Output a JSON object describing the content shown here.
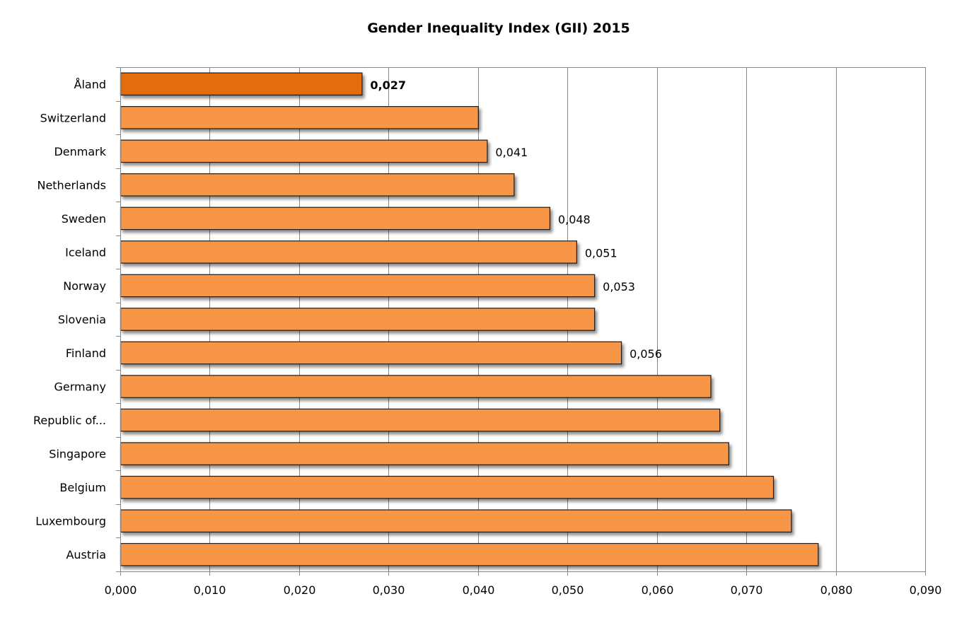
{
  "chart_data": {
    "type": "bar",
    "orientation": "horizontal",
    "title": "Gender Inequality Index (GII) 2015",
    "xlabel": "",
    "ylabel": "",
    "xlim": [
      0,
      0.09
    ],
    "grid": true,
    "legend": "none",
    "categories": [
      "Åland",
      "Switzerland",
      "Denmark",
      "Netherlands",
      "Sweden",
      "Iceland",
      "Norway",
      "Slovenia",
      "Finland",
      "Germany",
      "Republic of...",
      "Singapore",
      "Belgium",
      "Luxembourg",
      "Austria"
    ],
    "values": [
      0.027,
      0.04,
      0.041,
      0.044,
      0.048,
      0.051,
      0.053,
      0.053,
      0.056,
      0.066,
      0.067,
      0.068,
      0.073,
      0.075,
      0.078
    ],
    "data_labels": [
      "0,027",
      "",
      "0,041",
      "",
      "0,048",
      "0,051",
      "0,053",
      "",
      "0,056",
      "",
      "",
      "",
      "",
      "",
      ""
    ],
    "highlight_index": 0,
    "x_ticks": [
      "0,000",
      "0,010",
      "0,020",
      "0,030",
      "0,040",
      "0,050",
      "0,060",
      "0,070",
      "0,080",
      "0,090"
    ],
    "colors": {
      "highlight": "#E36C0A",
      "bar": "#F79646",
      "bar_border": "#1a1a1a",
      "grid": "#868686"
    }
  }
}
